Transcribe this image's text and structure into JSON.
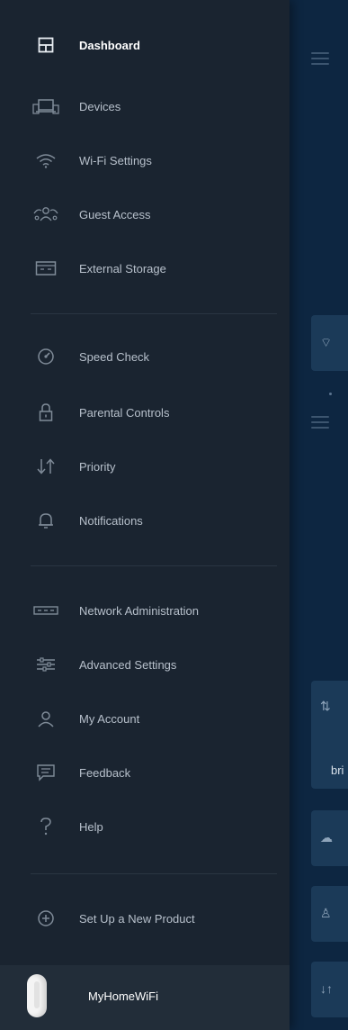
{
  "menu": {
    "primary": [
      {
        "label": "Dashboard",
        "icon": "dashboard-icon",
        "active": true
      },
      {
        "label": "Devices",
        "icon": "devices-icon"
      },
      {
        "label": "Wi-Fi Settings",
        "icon": "wifi-icon"
      },
      {
        "label": "Guest Access",
        "icon": "guest-access-icon"
      },
      {
        "label": "External Storage",
        "icon": "external-storage-icon"
      }
    ],
    "tools": [
      {
        "label": "Speed Check",
        "icon": "speedometer-icon"
      },
      {
        "label": "Parental Controls",
        "icon": "lock-icon"
      },
      {
        "label": "Priority",
        "icon": "priority-arrows-icon"
      },
      {
        "label": "Notifications",
        "icon": "bell-icon"
      }
    ],
    "settings": [
      {
        "label": "Network Administration",
        "icon": "router-icon"
      },
      {
        "label": "Advanced Settings",
        "icon": "sliders-icon"
      },
      {
        "label": "My Account",
        "icon": "user-icon"
      },
      {
        "label": "Feedback",
        "icon": "feedback-icon"
      },
      {
        "label": "Help",
        "icon": "help-icon"
      }
    ],
    "setup": {
      "label": "Set Up a New Product",
      "icon": "add-circle-icon"
    }
  },
  "footer": {
    "network_name": "MyHomeWiFi",
    "icon": "mesh-node-icon"
  },
  "background": {
    "card_text": "bri"
  },
  "colors": {
    "drawer": "#1a2430",
    "main": "#0d2641",
    "card": "#1b3a58",
    "active_text": "#ffffff"
  }
}
